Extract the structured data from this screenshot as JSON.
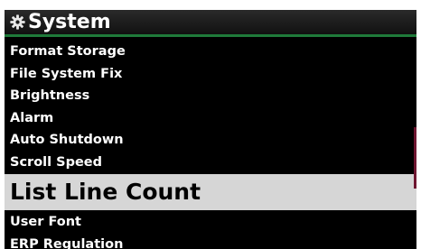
{
  "header": {
    "title": "System",
    "icon": "gear-icon"
  },
  "menu": {
    "items": [
      {
        "label": "Format Storage"
      },
      {
        "label": "File System Fix"
      },
      {
        "label": "Brightness"
      },
      {
        "label": "Alarm"
      },
      {
        "label": "Auto Shutdown"
      },
      {
        "label": "Scroll Speed"
      },
      {
        "label": "List Line Count",
        "selected": true
      },
      {
        "label": "User Font"
      },
      {
        "label": "ERP Regulation"
      }
    ]
  },
  "colors": {
    "background": "#000000",
    "header_accent": "#1f7a3a",
    "selection_bg": "#d6d6d6",
    "scrollbar": "#6e1630"
  }
}
